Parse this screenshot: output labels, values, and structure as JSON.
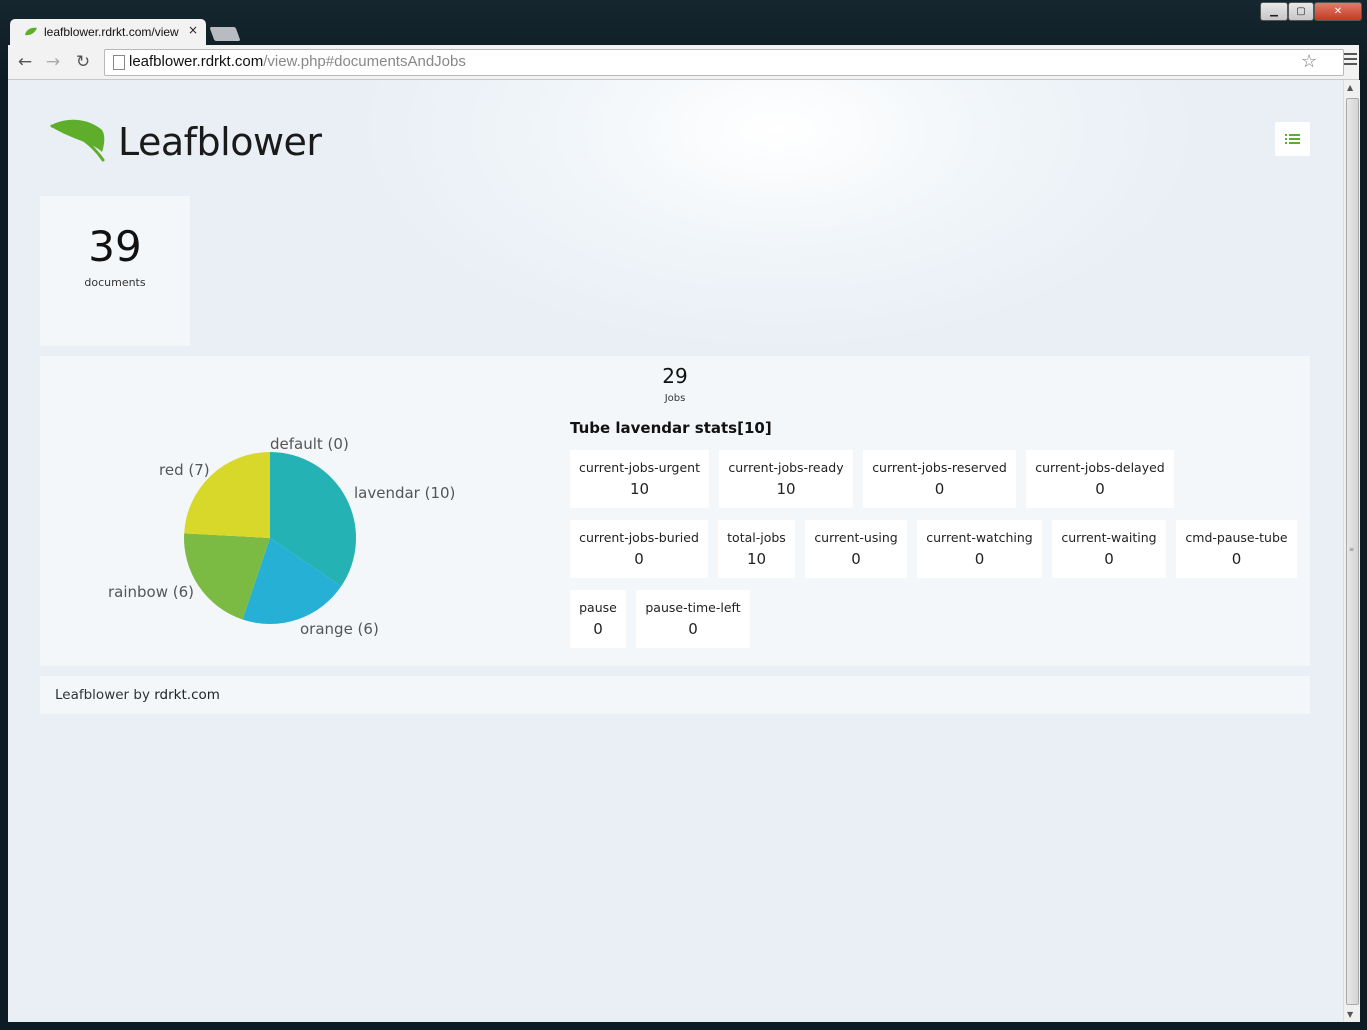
{
  "browser": {
    "tab_title": "leafblower.rdrkt.com/view",
    "tab_close": "×",
    "url_host": "leafblower.rdrkt.com",
    "url_path": "/view.php#documentsAndJobs",
    "window_min": "▁",
    "window_max": "▢",
    "window_close": "✕",
    "back": "←",
    "forward": "→",
    "reload": "↻",
    "star": "☆"
  },
  "header": {
    "brand": "Leafblower",
    "menu_icon": "list-icon",
    "accent": "#5eae2c"
  },
  "documents": {
    "count": "39",
    "label": "documents"
  },
  "jobs": {
    "count": "29",
    "label": "Jobs"
  },
  "chart_data": {
    "type": "pie",
    "slices": [
      {
        "label": "lavendar (10)",
        "value": 10,
        "color": "#25b2b4"
      },
      {
        "label": "orange (6)",
        "value": 6,
        "color": "#26b0d6"
      },
      {
        "label": "rainbow (6)",
        "value": 6,
        "color": "#7bba43"
      },
      {
        "label": "red (7)",
        "value": 7,
        "color": "#d8d82b"
      },
      {
        "label": "default (0)",
        "value": 0,
        "color": "#cccccc"
      }
    ]
  },
  "tube_stats": {
    "title": "Tube lavendar stats[10]",
    "rows": [
      [
        {
          "name": "current-jobs-urgent",
          "value": "10"
        },
        {
          "name": "current-jobs-ready",
          "value": "10"
        },
        {
          "name": "current-jobs-reserved",
          "value": "0"
        },
        {
          "name": "current-jobs-delayed",
          "value": "0"
        }
      ],
      [
        {
          "name": "current-jobs-buried",
          "value": "0"
        },
        {
          "name": "total-jobs",
          "value": "10"
        },
        {
          "name": "current-using",
          "value": "0"
        },
        {
          "name": "current-watching",
          "value": "0"
        },
        {
          "name": "current-waiting",
          "value": "0"
        },
        {
          "name": "cmd-pause-tube",
          "value": "0"
        }
      ],
      [
        {
          "name": "pause",
          "value": "0"
        },
        {
          "name": "pause-time-left",
          "value": "0"
        }
      ]
    ]
  },
  "footer": {
    "text": "Leafblower by ",
    "link": "rdrkt.com"
  }
}
